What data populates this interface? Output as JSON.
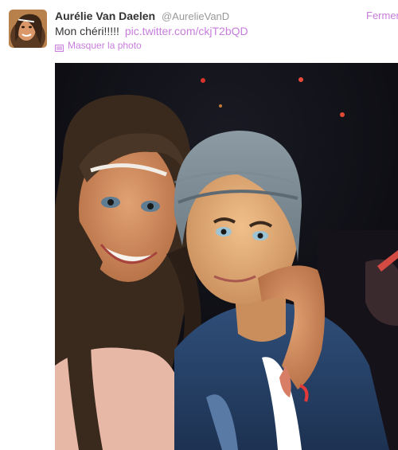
{
  "tweet": {
    "fullname": "Aurélie Van Daelen",
    "username": "@AurelieVanD",
    "close_label": "Fermer",
    "text": "Mon chéri!!!!!",
    "link": "pic.twitter.com/ckjT2bQD",
    "hide_photo_label": "Masquer la photo",
    "icons": {
      "photo": "photo-icon"
    }
  },
  "colors": {
    "link": "#c77ddb",
    "name": "#333333",
    "muted": "#999999"
  }
}
